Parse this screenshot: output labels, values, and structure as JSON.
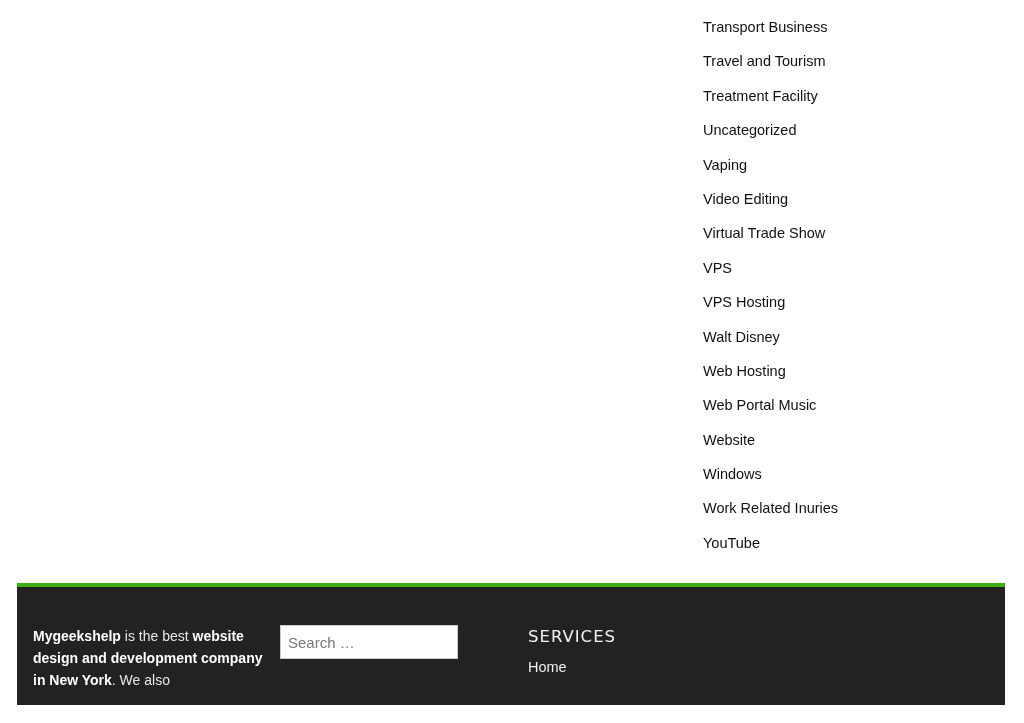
{
  "categories": [
    {
      "label": "Transport Business"
    },
    {
      "label": "Travel and Tourism"
    },
    {
      "label": "Treatment Facility"
    },
    {
      "label": "Uncategorized"
    },
    {
      "label": "Vaping"
    },
    {
      "label": "Video Editing"
    },
    {
      "label": "Virtual Trade Show"
    },
    {
      "label": "VPS"
    },
    {
      "label": "VPS Hosting"
    },
    {
      "label": "Walt Disney"
    },
    {
      "label": "Web Hosting"
    },
    {
      "label": "Web Portal Music"
    },
    {
      "label": "Website"
    },
    {
      "label": "Windows"
    },
    {
      "label": "Work Related Inuries"
    },
    {
      "label": "YouTube"
    }
  ],
  "footer": {
    "about": "**Mygeekshelp** is the best **website design and development company in New York**. We also",
    "search": {
      "placeholder": "Search …"
    },
    "services": {
      "title": "SERVICES",
      "links": [
        "Home"
      ]
    }
  }
}
